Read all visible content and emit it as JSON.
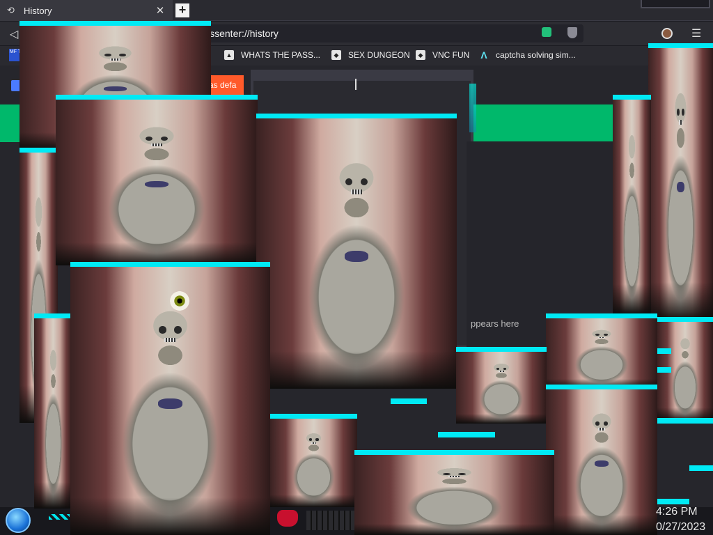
{
  "tab": {
    "icon": "history-icon",
    "title": "History",
    "close": "✕",
    "new": "+"
  },
  "nav": {
    "back": "◁",
    "url": "issenter://history",
    "menu": "☰"
  },
  "bookmarks": [
    {
      "label": "WHATS THE PASS...",
      "icon": "bookmark-icon"
    },
    {
      "label": "SEX DUNGEON",
      "icon": "bookmark-icon"
    },
    {
      "label": "VNC FUN",
      "icon": "bookmark-icon"
    },
    {
      "label": "captcha solving sim...",
      "icon": "bookmark-icon"
    }
  ],
  "mft_badge": "MF T",
  "orange_tag": "as defa",
  "empty_hint": "ppears here",
  "clock": {
    "time": "4:26 PM",
    "date": "0/27/2023"
  },
  "colors": {
    "accent_cyan": "#00eaf5",
    "banner_green": "#00b86b",
    "tag_orange": "#ff5a2a"
  }
}
